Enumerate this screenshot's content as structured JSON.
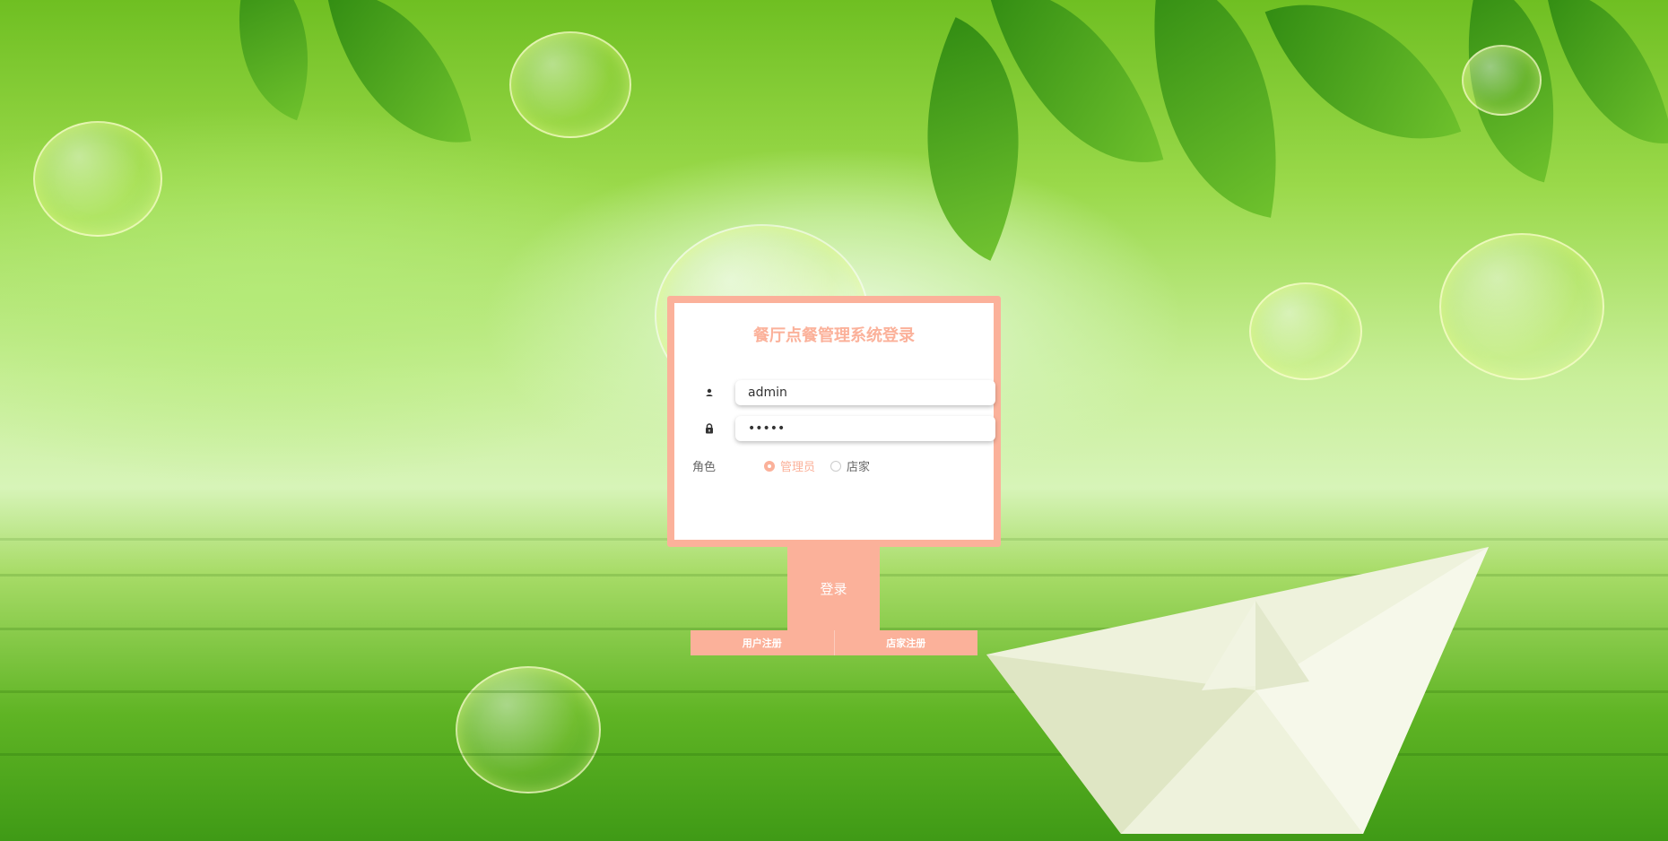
{
  "page": {
    "title": "餐厅点餐管理系统登录"
  },
  "form": {
    "username_value": "admin",
    "password_value": "admin",
    "role_label": "角色",
    "roles": [
      {
        "label": "管理员",
        "checked": true
      },
      {
        "label": "店家",
        "checked": false
      }
    ]
  },
  "buttons": {
    "login": "登录",
    "user_register": "用户注册",
    "shop_register": "店家注册"
  },
  "theme": {
    "accent": "#fbb19a",
    "background": "#9ad94a"
  },
  "icons": {
    "username": "user-icon",
    "password": "lock-icon"
  }
}
